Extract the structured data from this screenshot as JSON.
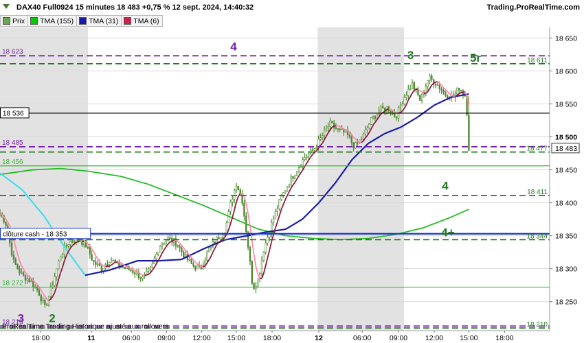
{
  "header": {
    "title": "DAX40 Full0924 15 minutes 18 483 +0,75 % 12 sept. 2024, 14:40:32",
    "brand": "Trading.ProRealTime.com"
  },
  "legend": [
    {
      "label": "Prix",
      "color": "#6aa84f"
    },
    {
      "label": "TMA (155)",
      "color": "#00cc00"
    },
    {
      "label": "TMA (31)",
      "color": "#1a1aa6"
    },
    {
      "label": "TMA (6)",
      "color": "#cc2244"
    }
  ],
  "footer_text": "ProRealTime Trading Historique ajusté aux rollovers",
  "colors": {
    "background": "#ffffff",
    "shade": "#e2e2e2",
    "candle": "#4f8a2f",
    "tma155": "#22bb22",
    "tma31_up": "#1a1aa6",
    "tma31_down": "#44ddee",
    "tma6_up": "#8b1a3a",
    "tma6_down": "#ff88aa",
    "level_purple": "#7a22aa",
    "level_green": "#227722",
    "line_blue": "#1a35cc"
  },
  "chart_data": {
    "type": "candlestick",
    "ylim": [
      18206,
      18666
    ],
    "y_ticks": [
      "18 650",
      "18 600",
      "18 550",
      "18 500",
      "18 450",
      "18 400",
      "18 350",
      "18 300",
      "18 250"
    ],
    "y_tick_values": [
      18650,
      18600,
      18550,
      18500,
      18450,
      18400,
      18350,
      18300,
      18250
    ],
    "x_labels": [
      {
        "label": "18:00",
        "t": 0.074,
        "bold": false
      },
      {
        "label": "11",
        "t": 0.166,
        "bold": true
      },
      {
        "label": "06:00",
        "t": 0.239,
        "bold": false
      },
      {
        "label": "09:00",
        "t": 0.303,
        "bold": false
      },
      {
        "label": "12:00",
        "t": 0.367,
        "bold": false
      },
      {
        "label": "15:00",
        "t": 0.43,
        "bold": false
      },
      {
        "label": "18:00",
        "t": 0.495,
        "bold": false
      },
      {
        "label": "12",
        "t": 0.58,
        "bold": true
      },
      {
        "label": "06:00",
        "t": 0.659,
        "bold": false
      },
      {
        "label": "09:00",
        "t": 0.725,
        "bold": false
      },
      {
        "label": "12:00",
        "t": 0.79,
        "bold": false
      },
      {
        "label": "15:00",
        "t": 0.853,
        "bold": false
      },
      {
        "label": "18:00",
        "t": 0.918,
        "bold": false
      }
    ],
    "shaded_regions": [
      [
        0.0,
        0.16
      ],
      [
        0.578,
        0.735
      ]
    ],
    "close_path": [
      [
        0.0,
        18385
      ],
      [
        0.01,
        18370
      ],
      [
        0.025,
        18310
      ],
      [
        0.04,
        18290
      ],
      [
        0.055,
        18282
      ],
      [
        0.07,
        18265
      ],
      [
        0.082,
        18240
      ],
      [
        0.095,
        18275
      ],
      [
        0.11,
        18320
      ],
      [
        0.125,
        18340
      ],
      [
        0.14,
        18345
      ],
      [
        0.155,
        18338
      ],
      [
        0.17,
        18310
      ],
      [
        0.185,
        18300
      ],
      [
        0.2,
        18315
      ],
      [
        0.215,
        18305
      ],
      [
        0.23,
        18300
      ],
      [
        0.245,
        18295
      ],
      [
        0.26,
        18285
      ],
      [
        0.275,
        18300
      ],
      [
        0.29,
        18335
      ],
      [
        0.305,
        18345
      ],
      [
        0.32,
        18340
      ],
      [
        0.335,
        18320
      ],
      [
        0.35,
        18305
      ],
      [
        0.365,
        18300
      ],
      [
        0.38,
        18330
      ],
      [
        0.395,
        18345
      ],
      [
        0.41,
        18360
      ],
      [
        0.42,
        18400
      ],
      [
        0.43,
        18430
      ],
      [
        0.44,
        18408
      ],
      [
        0.45,
        18345
      ],
      [
        0.46,
        18270
      ],
      [
        0.47,
        18285
      ],
      [
        0.48,
        18330
      ],
      [
        0.495,
        18370
      ],
      [
        0.51,
        18405
      ],
      [
        0.525,
        18430
      ],
      [
        0.54,
        18450
      ],
      [
        0.555,
        18470
      ],
      [
        0.57,
        18480
      ],
      [
        0.585,
        18500
      ],
      [
        0.6,
        18520
      ],
      [
        0.615,
        18510
      ],
      [
        0.63,
        18505
      ],
      [
        0.645,
        18485
      ],
      [
        0.66,
        18500
      ],
      [
        0.675,
        18525
      ],
      [
        0.69,
        18540
      ],
      [
        0.705,
        18545
      ],
      [
        0.72,
        18530
      ],
      [
        0.735,
        18560
      ],
      [
        0.75,
        18580
      ],
      [
        0.765,
        18555
      ],
      [
        0.78,
        18590
      ],
      [
        0.795,
        18580
      ],
      [
        0.81,
        18565
      ],
      [
        0.825,
        18560
      ],
      [
        0.835,
        18575
      ],
      [
        0.842,
        18568
      ],
      [
        0.848,
        18560
      ],
      [
        0.853,
        18483
      ]
    ],
    "tma155": [
      [
        0.0,
        18443
      ],
      [
        0.06,
        18450
      ],
      [
        0.11,
        18452
      ],
      [
        0.16,
        18448
      ],
      [
        0.22,
        18440
      ],
      [
        0.27,
        18428
      ],
      [
        0.32,
        18412
      ],
      [
        0.37,
        18396
      ],
      [
        0.42,
        18378
      ],
      [
        0.47,
        18360
      ],
      [
        0.52,
        18350
      ],
      [
        0.57,
        18346
      ],
      [
        0.62,
        18344
      ],
      [
        0.67,
        18346
      ],
      [
        0.72,
        18352
      ],
      [
        0.77,
        18362
      ],
      [
        0.82,
        18378
      ],
      [
        0.853,
        18390
      ]
    ],
    "tma31": [
      [
        0.0,
        18445
      ],
      [
        0.04,
        18420
      ],
      [
        0.08,
        18380
      ],
      [
        0.12,
        18330
      ],
      [
        0.155,
        18290
      ],
      [
        0.2,
        18298
      ],
      [
        0.25,
        18312
      ],
      [
        0.29,
        18312
      ],
      [
        0.33,
        18314
      ],
      [
        0.37,
        18330
      ],
      [
        0.41,
        18344
      ],
      [
        0.45,
        18350
      ],
      [
        0.48,
        18355
      ],
      [
        0.52,
        18360
      ],
      [
        0.55,
        18375
      ],
      [
        0.58,
        18400
      ],
      [
        0.61,
        18430
      ],
      [
        0.64,
        18465
      ],
      [
        0.67,
        18490
      ],
      [
        0.7,
        18505
      ],
      [
        0.73,
        18515
      ],
      [
        0.76,
        18530
      ],
      [
        0.79,
        18548
      ],
      [
        0.82,
        18560
      ],
      [
        0.853,
        18565
      ]
    ],
    "levels": [
      {
        "value": 18623,
        "label": "18 623",
        "color": "#7a22aa",
        "dash": true,
        "side": "left"
      },
      {
        "value": 18611,
        "label": "18 611",
        "color": "#227722",
        "dash": true,
        "side": "right"
      },
      {
        "value": 18536,
        "label": "18 536",
        "color": "#000000",
        "dash": false,
        "side": "leftbox"
      },
      {
        "value": 18485,
        "label": "18 485",
        "color": "#7a22aa",
        "dash": true,
        "side": "left"
      },
      {
        "value": 18477,
        "label": "18 477",
        "color": "#227722",
        "dash": true,
        "side": "right"
      },
      {
        "value": 18456,
        "label": "18 456",
        "color": "#33bb33",
        "dash": false,
        "side": "left"
      },
      {
        "value": 18411,
        "label": "18 411",
        "color": "#227722",
        "dash": true,
        "side": "right"
      },
      {
        "value": 18353,
        "label": "clôture cash -  18 353",
        "color": "#1a35cc",
        "dash": false,
        "side": "leftbox"
      },
      {
        "value": 18344,
        "label": "18 344",
        "color": "#227722",
        "dash": true,
        "side": "right"
      },
      {
        "value": 18272,
        "label": "18 272",
        "color": "#33bb33",
        "dash": false,
        "side": "left"
      },
      {
        "value": 18213,
        "label": "18 213",
        "color": "#7a22aa",
        "dash": true,
        "side": "left"
      },
      {
        "value": 18210,
        "label": "18 210",
        "color": "#227722",
        "dash": true,
        "side": "right"
      }
    ],
    "current_price": {
      "value": 18483,
      "label": "18 483"
    },
    "annotations": [
      {
        "text": "4",
        "t": 0.425,
        "y": 18631,
        "color": "#7a22aa"
      },
      {
        "text": "3",
        "t": 0.747,
        "y": 18618,
        "color": "#227722"
      },
      {
        "text": "5r",
        "t": 0.865,
        "y": 18614,
        "color": "#227722"
      },
      {
        "text": "4",
        "t": 0.81,
        "y": 18420,
        "color": "#227722"
      },
      {
        "text": "4+",
        "t": 0.815,
        "y": 18349,
        "color": "#227722"
      },
      {
        "text": "2",
        "t": 0.095,
        "y": 18219,
        "color": "#227722"
      },
      {
        "text": "3",
        "t": 0.038,
        "y": 18219,
        "color": "#7a22aa"
      }
    ]
  }
}
